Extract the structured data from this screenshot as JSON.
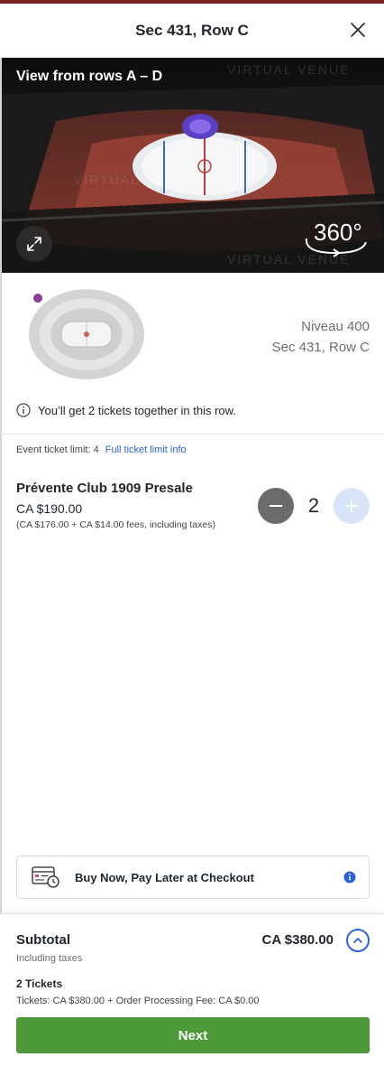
{
  "header": {
    "title": "Sec 431, Row C"
  },
  "view": {
    "title": "View from rows A – D",
    "watermark": "VIRTUAL VENUE",
    "badge": "360°"
  },
  "section": {
    "level": "Niveau 400",
    "seat": "Sec 431, Row C"
  },
  "notice": {
    "text": "You’ll get 2 tickets together in this row."
  },
  "limit": {
    "text": "Event ticket limit: 4",
    "link": "Full ticket limit info"
  },
  "ticket": {
    "name": "Prévente Club 1909 Presale",
    "price": "CA $190.00",
    "fees": "(CA $176.00 + CA $14.00 fees, including taxes)",
    "quantity": "2"
  },
  "bnpl": {
    "label": "Buy Now, Pay Later at Checkout"
  },
  "footer": {
    "subtotal_label": "Subtotal",
    "subtotal_sub": "Including taxes",
    "subtotal_amount": "CA $380.00",
    "tickets_count": "2 Tickets",
    "tickets_detail": "Tickets: CA $380.00 + Order Processing Fee: CA $0.00",
    "next_label": "Next"
  },
  "colors": {
    "accent_blue": "#2a64dc",
    "next_green": "#4e9a3a",
    "top_bar": "#7a1f1f",
    "marker_purple": "#8b3d9a"
  },
  "icons": [
    "close-icon",
    "expand-icon",
    "rotate-360-icon",
    "info-icon",
    "minus-icon",
    "plus-icon",
    "calendar-clock-icon",
    "info-filled-icon",
    "chevron-up-icon"
  ]
}
